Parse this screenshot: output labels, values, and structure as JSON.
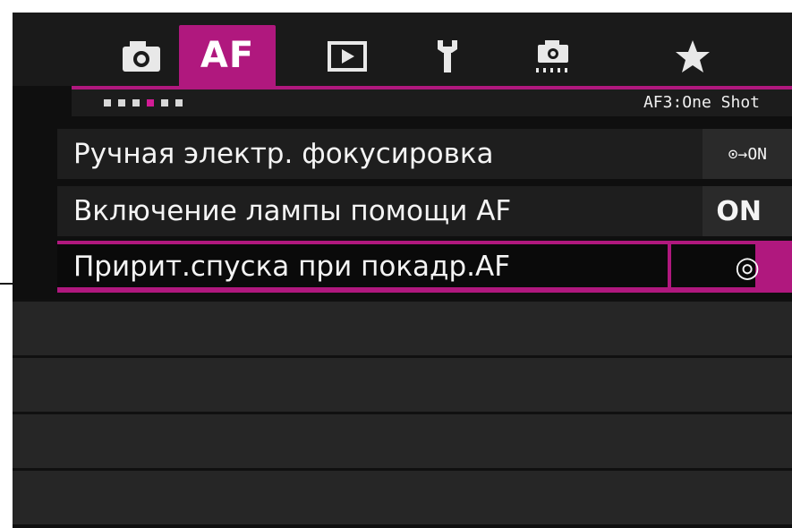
{
  "tabs": [
    {
      "name": "camera-icon",
      "label": ""
    },
    {
      "name": "af",
      "label": "AF"
    },
    {
      "name": "playback-icon",
      "label": ""
    },
    {
      "name": "wrench-icon",
      "label": ""
    },
    {
      "name": "custom-camera-icon",
      "label": ""
    },
    {
      "name": "star-icon",
      "label": ""
    }
  ],
  "active_tab": "AF",
  "page_indicator": {
    "count": 6,
    "active_index": 3
  },
  "subtitle": "AF3:One Shot",
  "menu": {
    "items": [
      {
        "label": "Ручная электр. фокусировка",
        "value": "⊙→ON"
      },
      {
        "label": "Включение лампы помощи AF",
        "value": "ON"
      },
      {
        "label": "Пририт.спуска при покадр.AF",
        "value": "◎"
      }
    ]
  },
  "colors": {
    "accent": "#b0187e",
    "background": "#0f0f0f"
  }
}
